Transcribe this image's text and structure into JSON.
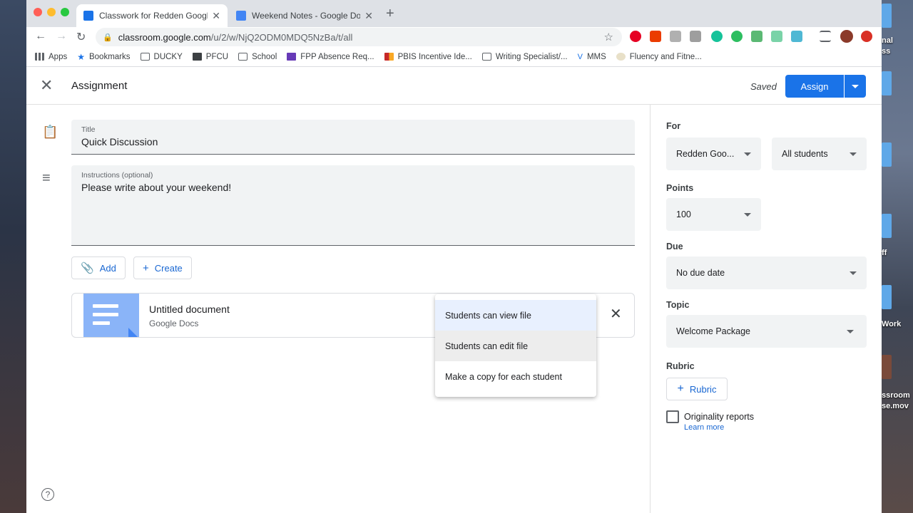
{
  "colors": {
    "accent": "#1a73e8",
    "link": "#1967d2",
    "field_bg": "#f1f3f4",
    "menu_selected": "#e8f0fe"
  },
  "desktop": {
    "labels": [
      "nal",
      "ss",
      "ff",
      "Work",
      "ssroom",
      "se.mov"
    ]
  },
  "browser": {
    "tabs": [
      {
        "title": "Classwork for Redden Google",
        "icon": "classroom-icon",
        "color": "#1a73e8",
        "active": true
      },
      {
        "title": "Weekend Notes - Google Docs",
        "icon": "docs-icon",
        "color": "#4285f4",
        "active": false
      }
    ],
    "new_tab": "+",
    "url_host": "classroom.google.com",
    "url_path": "/u/2/w/NjQ2ODM0MDQ5NzBa/t/all",
    "extension_icons": [
      "pinterest-icon",
      "office-icon",
      "ext-icon",
      "chart-icon",
      "grammarly-icon",
      "evernote-icon",
      "ext-green-icon",
      "n-icon",
      "n-ext-icon",
      "reading-list-icon",
      "profile-avatar",
      "adblock-icon"
    ],
    "bookmarks": [
      {
        "label": "Apps",
        "icon": "apps-grid-icon"
      },
      {
        "label": "Bookmarks",
        "icon": "star-icon"
      },
      {
        "label": "DUCKY",
        "icon": "folder-icon"
      },
      {
        "label": "PFCU",
        "icon": "bank-icon"
      },
      {
        "label": "School",
        "icon": "folder-icon"
      },
      {
        "label": "FPP Absence Req...",
        "icon": "forms-icon"
      },
      {
        "label": "PBIS Incentive Ide...",
        "icon": "pbis-icon"
      },
      {
        "label": "Writing Specialist/...",
        "icon": "folder-icon"
      },
      {
        "label": "MMS",
        "icon": "mms-icon"
      },
      {
        "label": "Fluency and Fitne...",
        "icon": "fluency-icon"
      }
    ]
  },
  "header": {
    "title": "Assignment",
    "status": "Saved",
    "assign_label": "Assign"
  },
  "form": {
    "title_label": "Title",
    "title_value": "Quick Discussion",
    "instructions_label": "Instructions (optional)",
    "instructions_value": "Please write about your weekend!",
    "add_label": "Add",
    "create_label": "Create",
    "attachment": {
      "name": "Untitled document",
      "type": "Google Docs"
    },
    "share_menu": {
      "items": [
        "Students can view file",
        "Students can edit file",
        "Make a copy for each student"
      ],
      "selected": "Students can view file"
    },
    "help": "?"
  },
  "sidebar": {
    "for_label": "For",
    "class_value": "Redden Goo...",
    "students_value": "All students",
    "points_label": "Points",
    "points_value": "100",
    "due_label": "Due",
    "due_value": "No due date",
    "topic_label": "Topic",
    "topic_value": "Welcome Package",
    "rubric_label": "Rubric",
    "rubric_button": "Rubric",
    "originality_label": "Originality reports",
    "learn_more": "Learn more"
  }
}
